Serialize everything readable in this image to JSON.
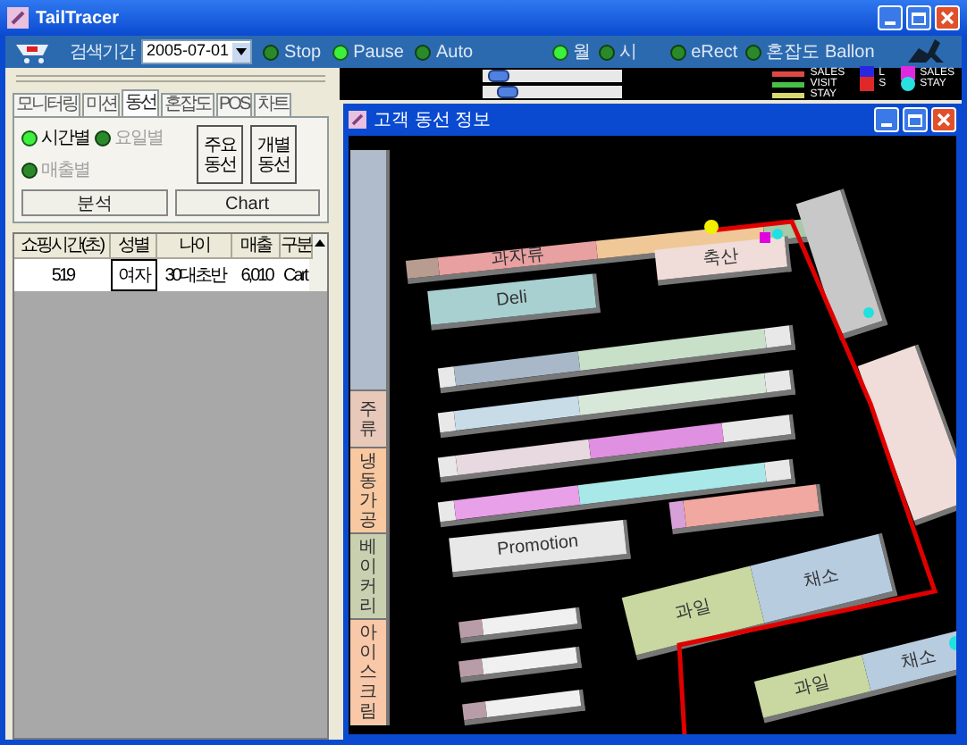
{
  "window": {
    "title": "TailTracer"
  },
  "toolbar": {
    "period_label": "검색기간",
    "date": "2005-07-01",
    "controls": [
      {
        "label": "Stop",
        "selected": false
      },
      {
        "label": "Pause",
        "selected": true
      },
      {
        "label": "Auto",
        "selected": false
      }
    ],
    "units": [
      {
        "label": "월",
        "selected": true
      },
      {
        "label": "시",
        "selected": false
      }
    ],
    "options": [
      {
        "label": "eRect",
        "selected": false
      },
      {
        "label": "혼잡도 Ballon",
        "selected": false
      }
    ]
  },
  "sliders": [
    {
      "level": 0.05
    },
    {
      "level": 0.12
    }
  ],
  "legend": [
    {
      "label": "SALES",
      "color": "#e04848",
      "kind": "line"
    },
    {
      "label": "VISIT",
      "color": "#48c048",
      "kind": "line"
    },
    {
      "label": "STAY",
      "color": "#d8d870",
      "kind": "line"
    },
    {
      "label": "L",
      "color": "#2828e0",
      "kind": "square"
    },
    {
      "label": "S",
      "color": "#e02828",
      "kind": "square"
    },
    {
      "label": "SALES",
      "color": "#e028e0",
      "kind": "square"
    },
    {
      "label": "STAY",
      "color": "#28e0e0",
      "kind": "circle"
    }
  ],
  "tabs": [
    {
      "label": "모니터링",
      "selected": false
    },
    {
      "label": "미션",
      "selected": false
    },
    {
      "label": "동선",
      "selected": true
    },
    {
      "label": "혼잡도",
      "selected": false
    },
    {
      "label": "POS",
      "selected": false
    },
    {
      "label": "차트",
      "selected": false
    }
  ],
  "view_options": [
    {
      "label": "시간별",
      "selected": true
    },
    {
      "label": "요일별",
      "selected": false
    },
    {
      "label": "매출별",
      "selected": false
    }
  ],
  "route_buttons": [
    "주요 동선",
    "개별 동선"
  ],
  "actions": [
    "분석",
    "Chart"
  ],
  "table": {
    "columns": [
      "쇼핑시간(초)",
      "성별",
      "나이",
      "매출",
      "구분"
    ],
    "rows": [
      [
        "519",
        "여자",
        "30대초반",
        "6,010",
        "Cart"
      ]
    ]
  },
  "map_window": {
    "title": "고객 동선 정보",
    "sections": [
      "과자류",
      "Deli",
      "축산",
      "Promotion",
      "과일",
      "채소",
      "과일",
      "채소",
      "주류",
      "냉동가공",
      "베이커리",
      "아이스크림"
    ]
  }
}
